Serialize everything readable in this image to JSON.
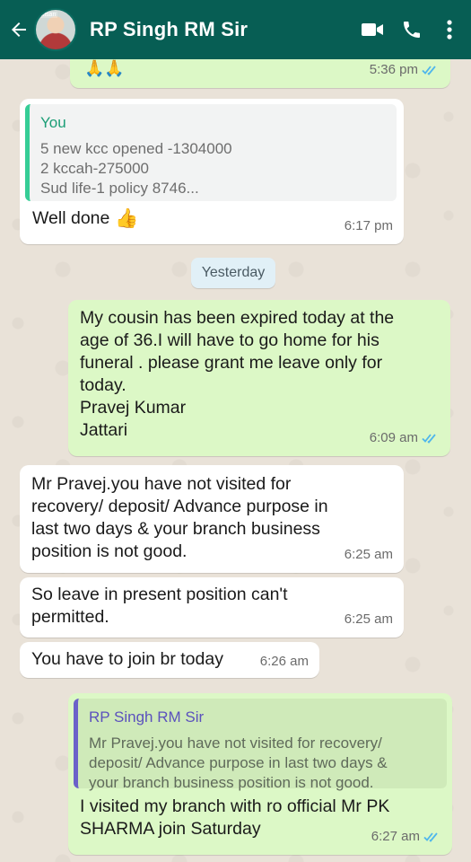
{
  "header": {
    "contact_name": "RP Singh RM Sir",
    "avatar_tag": "kisan"
  },
  "messages": [
    {
      "type": "outgoing",
      "text": "",
      "emoji": "🙏🙏",
      "time": "5:36 pm",
      "status": "read"
    },
    {
      "type": "incoming",
      "quote": {
        "author": "You",
        "lines": "5 new kcc opened -1304000\n2 kccah-275000\nSud life-1 policy 8746..."
      },
      "text": "Well done",
      "emoji": "👍",
      "time": "6:17 pm"
    },
    {
      "type": "date",
      "label": "Yesterday"
    },
    {
      "type": "outgoing",
      "text": "My cousin has been expired today at the\nage of 36.I will have to go home for his\nfuneral . please grant me leave only for\ntoday.\nPravej Kumar\nJattari",
      "time": "6:09 am",
      "status": "read"
    },
    {
      "type": "incoming",
      "text": "Mr Pravej.you have not visited for\nrecovery/ deposit/ Advance purpose in\nlast two days & your branch business\nposition is not good.",
      "time": "6:25 am"
    },
    {
      "type": "incoming",
      "text": "So leave in present position can't\npermitted.",
      "time": "6:25 am"
    },
    {
      "type": "incoming",
      "text": "You have to join br today",
      "time": "6:26 am"
    },
    {
      "type": "outgoing",
      "quote": {
        "author": "RP Singh RM Sir",
        "lines": "Mr Pravej.you have not visited for recovery/\ndeposit/ Advance purpose in last two days &\nyour branch business position is not good."
      },
      "text": "I visited my branch with ro official Mr PK\nSHARMA join Saturday",
      "time": "6:27 am",
      "status": "read"
    }
  ],
  "colors": {
    "header": "#075e54",
    "outgoing_bubble": "#dcf8c6",
    "incoming_bubble": "#ffffff",
    "read_ticks": "#4fb6ec",
    "quote_you": "#35cd96",
    "quote_contact": "#6b61c9"
  },
  "icons": {
    "back": "arrow-left-icon",
    "video": "video-camera-icon",
    "call": "phone-icon",
    "menu": "more-vertical-icon"
  }
}
